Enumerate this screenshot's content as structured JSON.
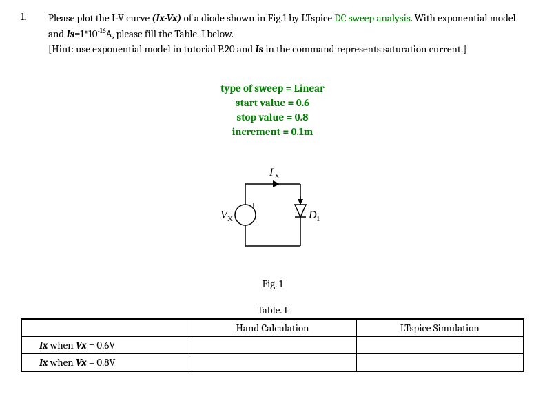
{
  "question_number": "1.",
  "question": {
    "part1_a": "Please plot the I-V curve ",
    "part1_b": "(Ix-Vx)",
    "part1_c": " of a diode shown in Fig.1 by LTspice ",
    "dc_sweep": "DC sweep analysis",
    "part2_a": ". With exponential model and ",
    "is_label": "Is",
    "part2_b": "=1*10",
    "exp": "-16",
    "part2_c": "A, please fill the Table. I below.",
    "hint_a": "[Hint: use exponential model in tutorial P.20 and ",
    "hint_is": "Is",
    "hint_b": " in the command represents saturation current.]"
  },
  "sweep": {
    "line1": "type of sweep = Linear",
    "line2": "start value = 0.6",
    "line3": "stop value = 0.8",
    "line4": "increment = 0.1m"
  },
  "circuit": {
    "ix_label": "I",
    "ix_sub": "X",
    "vx_label": "V",
    "vx_sub": "X",
    "d1_label": "D",
    "d1_sub": "1",
    "plus": "+",
    "minus": "−"
  },
  "figure_label": "Fig. 1",
  "table_label": "Table. I",
  "table": {
    "col1_header": "Hand Calculation",
    "col2_header": "LTspice Simulation",
    "row1_label_a": "Ix",
    "row1_label_b": " when ",
    "row1_label_c": "Vx",
    "row1_label_d": " = 0.6V",
    "row2_label_a": "Ix",
    "row2_label_b": " when ",
    "row2_label_c": "Vx",
    "row2_label_d": " = 0.8V"
  }
}
